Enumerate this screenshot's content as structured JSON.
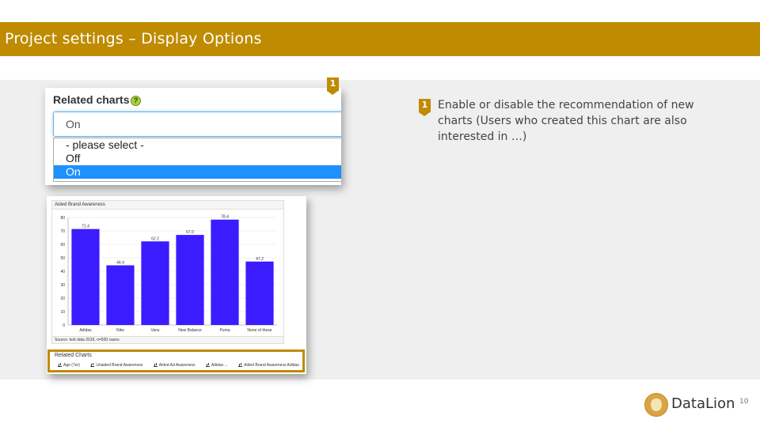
{
  "header": {
    "title": "Project settings – Display Options"
  },
  "dropdown_screenshot": {
    "label": "Related charts",
    "help_icon": "question-icon",
    "help_symbol": "?",
    "selected_value": "On",
    "options": [
      "- please select -",
      "Off",
      "On"
    ],
    "highlighted_option": "On",
    "marker": "1"
  },
  "description": {
    "marker": "1",
    "text": "Enable or disable the recommendation of new charts (Users who created this chart are also interested in …)"
  },
  "chart_screenshot": {
    "title": "Aided Brand Awareness",
    "source": "Source: test data 2019, n=500 cases",
    "related_title": "Related Charts",
    "related_links": [
      "Age (7er)",
      "Unaided Brand Awareness",
      "Aided Ad Awareness",
      "Adidas ...",
      "Aided Brand Awareness Adidas"
    ]
  },
  "chart_data": {
    "type": "bar",
    "title": "Aided Brand Awareness",
    "categories": [
      "Adidas",
      "Nike",
      "Vans",
      "New Balance",
      "Puma",
      "None of these"
    ],
    "values": [
      71.4,
      44.4,
      62.2,
      67.0,
      78.4,
      47.2
    ],
    "value_labels": [
      "71.4",
      "44.4",
      "62.2",
      "67.0",
      "78.4",
      "47.2"
    ],
    "ylim": [
      0,
      80
    ],
    "yticks": [
      0,
      10,
      20,
      30,
      40,
      50,
      60,
      70,
      80
    ],
    "bar_color": "#3b1cff",
    "grid": true
  },
  "colors": {
    "accent": "#bf8b00",
    "select_highlight": "#1e90ff"
  },
  "footer": {
    "logo_text": "DataLion",
    "logo_icon": "lion-icon",
    "page_number": "10"
  }
}
